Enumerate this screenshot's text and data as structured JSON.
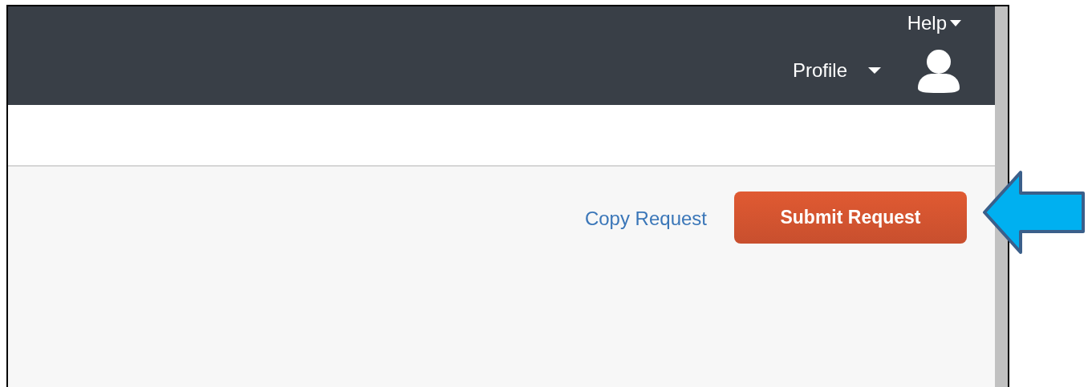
{
  "header": {
    "help_menu": {
      "label": "Help"
    },
    "profile_menu": {
      "label": "Profile"
    }
  },
  "toolbar": {
    "actions": [
      {
        "kind": "link",
        "label": "Copy Request"
      },
      {
        "kind": "primary",
        "label": "Submit Request"
      }
    ]
  }
}
